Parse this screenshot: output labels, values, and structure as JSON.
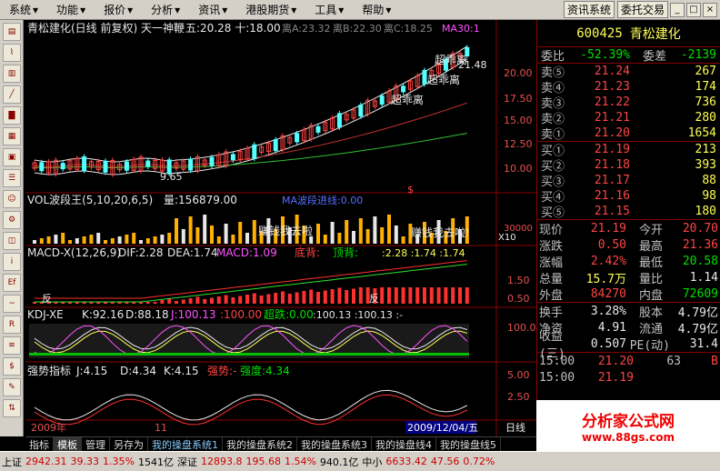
{
  "menu": [
    "系统",
    "功能",
    "报价",
    "分析",
    "资讯",
    "港股期货",
    "工具",
    "帮助"
  ],
  "menu_right": [
    "资讯系统",
    "委托交易"
  ],
  "chart_header": {
    "title": "青松建化(日线 前复权) 天一神鞭",
    "params": "五:20.28 十:18.00",
    "extra1": "离A:23.32",
    "extra2": "离B:22.30",
    "extra3": "离C:18.25",
    "ma": "MA30:1"
  },
  "annotations": [
    "超乖离",
    "超乖离",
    "超乖离",
    "21.48",
    "9.65"
  ],
  "price_axis": [
    "20.00",
    "17.50",
    "15.00",
    "12.50",
    "10.00"
  ],
  "vol_header": {
    "title": "VOL波段王(5,10,20,6,5)",
    "vol": "量:156879.00",
    "mid": "MA波段进线:0.00"
  },
  "vol_texts": [
    "赚钱我去啦",
    "赚钱我去啦!"
  ],
  "vol_axis": [
    "30000",
    "X10"
  ],
  "macd_header": {
    "title": "MACD-X(12,26,9)",
    "dif": "DIF:2.28",
    "dea": "DEA:1.74",
    "macd": "MACD:1.09",
    "t1": "底背:",
    "t2": "顶背:",
    "r": ":2.28 :1.74 :1.74"
  },
  "macd_axis": [
    "1.50",
    "0.50"
  ],
  "macd_labels": [
    "反",
    "反"
  ],
  "kdj_header": {
    "title": "KDJ-XE",
    "k": "K:92.16",
    "d": "D:88.18",
    "j": "J:100.13",
    "a": ":100.00",
    "b": "超跌:0.00",
    "c": ":100.13 :100.13 :-"
  },
  "kdj_axis": [
    "100.0"
  ],
  "qs_header": {
    "title": "强势指标",
    "j": "J:4.15",
    "d": "D:4.34",
    "k": "K:4.15",
    "s": "强势:-",
    "q": "强度:4.34"
  },
  "qs_axis": [
    "5.00",
    "2.50"
  ],
  "date_axis": {
    "left": "2009年",
    "mid": "11",
    "right": "2009/12/04/五",
    "period": "日线"
  },
  "tabs": [
    "指标",
    "模板",
    "管理",
    "另存为",
    "我的操盘系统1",
    "我的操盘系统2",
    "我的操盘系统3",
    "我的操盘线4",
    "我的操盘线5"
  ],
  "stock": {
    "code": "600425",
    "name": "青松建化"
  },
  "weibi": {
    "l1": "委比",
    "v1": "-52.39%",
    "l2": "委差",
    "v2": "-2139"
  },
  "asks": [
    {
      "label": "卖⑤",
      "price": "21.24",
      "vol": "267"
    },
    {
      "label": "卖④",
      "price": "21.23",
      "vol": "174"
    },
    {
      "label": "卖③",
      "price": "21.22",
      "vol": "736"
    },
    {
      "label": "卖②",
      "price": "21.21",
      "vol": "280"
    },
    {
      "label": "卖①",
      "price": "21.20",
      "vol": "1654"
    }
  ],
  "bids": [
    {
      "label": "买①",
      "price": "21.19",
      "vol": "213"
    },
    {
      "label": "买②",
      "price": "21.18",
      "vol": "393"
    },
    {
      "label": "买③",
      "price": "21.17",
      "vol": "88"
    },
    {
      "label": "买④",
      "price": "21.16",
      "vol": "98"
    },
    {
      "label": "买⑤",
      "price": "21.15",
      "vol": "180"
    }
  ],
  "stats": [
    {
      "l": "现价",
      "v": "21.19",
      "l2": "今开",
      "v2": "20.70"
    },
    {
      "l": "涨跌",
      "v": "0.50",
      "l2": "最高",
      "v2": "21.36"
    },
    {
      "l": "涨幅",
      "v": "2.42%",
      "l2": "最低",
      "v2": "20.58"
    },
    {
      "l": "总量",
      "v": "15.7万",
      "l2": "量比",
      "v2": "1.14"
    },
    {
      "l": "外盘",
      "v": "84270",
      "l2": "内盘",
      "v2": "72609"
    },
    {
      "l": "换手",
      "v": "3.28%",
      "l2": "股本",
      "v2": "4.79亿"
    },
    {
      "l": "净资",
      "v": "4.91",
      "l2": "流通",
      "v2": "4.79亿"
    },
    {
      "l": "收益(三)",
      "v": "0.507",
      "l2": "PE(动)",
      "v2": "31.4"
    }
  ],
  "ticks": [
    {
      "t": "15:00",
      "p": "21.20",
      "v": "63",
      "s": "B"
    },
    {
      "t": "15:00",
      "p": "21.19",
      "v": "",
      "s": ""
    }
  ],
  "logo": {
    "t1": "分析家公式网",
    "t2": "www.88gs.com"
  },
  "statusbar": {
    "sh_label": "上证",
    "sh_idx": "2942.31",
    "sh_chg": "39.33",
    "sh_pct": "1.35%",
    "sh_amt": "1541亿",
    "sz_label": "深证",
    "sz_idx": "12893.8",
    "sz_chg": "195.68",
    "sz_pct": "1.54%",
    "sz_amt": "940.1亿",
    "zx_label": "中小",
    "zx_idx": "6633.42",
    "zx_chg": "47.56",
    "zx_pct": "0.72%"
  }
}
